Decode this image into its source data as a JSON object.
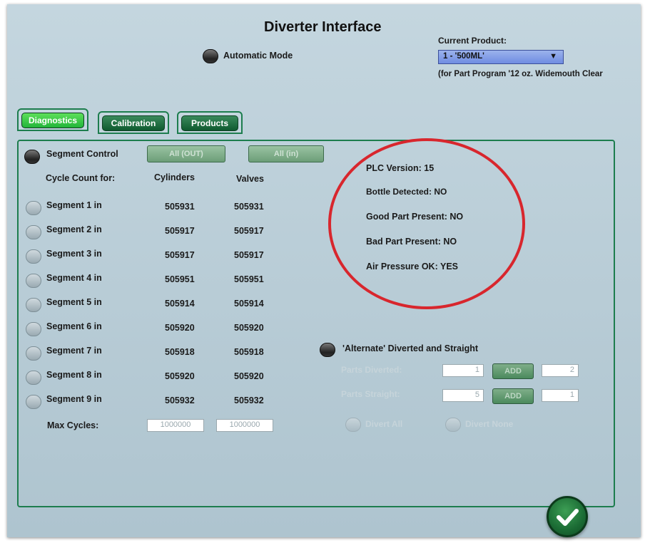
{
  "window": {
    "title": "Diverter Interface"
  },
  "header": {
    "automatic_mode_label": "Automatic Mode",
    "current_product_label": "Current Product:",
    "current_product_value": "1 - '500ML'",
    "part_program_note": "(for Part Program '12 oz. Widemouth Clear"
  },
  "tabs": [
    {
      "label": "Diagnostics",
      "active": true
    },
    {
      "label": "Calibration",
      "active": false
    },
    {
      "label": "Products",
      "active": false
    }
  ],
  "diagnostics": {
    "segment_control_label": "Segment Control",
    "all_out_label": "All (OUT)",
    "all_in_label": "All (in)",
    "cycle_count_label": "Cycle Count for:",
    "col_cylinders": "Cylinders",
    "col_valves": "Valves",
    "segments": [
      {
        "label": "Segment 1 in",
        "cylinders": "505931",
        "valves": "505931"
      },
      {
        "label": "Segment 2 in",
        "cylinders": "505917",
        "valves": "505917"
      },
      {
        "label": "Segment 3 in",
        "cylinders": "505917",
        "valves": "505917"
      },
      {
        "label": "Segment 4 in",
        "cylinders": "505951",
        "valves": "505951"
      },
      {
        "label": "Segment 5 in",
        "cylinders": "505914",
        "valves": "505914"
      },
      {
        "label": "Segment 6 in",
        "cylinders": "505920",
        "valves": "505920"
      },
      {
        "label": "Segment 7 in",
        "cylinders": "505918",
        "valves": "505918"
      },
      {
        "label": "Segment 8 in",
        "cylinders": "505920",
        "valves": "505920"
      },
      {
        "label": "Segment 9 in",
        "cylinders": "505932",
        "valves": "505932"
      }
    ],
    "max_cycles_label": "Max Cycles:",
    "max_cycles_cylinders": "1000000",
    "max_cycles_valves": "1000000"
  },
  "status": {
    "plc_version": "PLC Version: 15",
    "bottle_detected": "Bottle Detected: NO",
    "good_part_present": "Good Part Present: NO",
    "bad_part_present": "Bad Part Present: NO",
    "air_pressure_ok": "Air Pressure OK: YES"
  },
  "alternate": {
    "label": "'Alternate' Diverted and Straight",
    "parts_diverted_label": "Parts Diverted:",
    "parts_diverted_value": "1",
    "parts_diverted_add": "2",
    "parts_straight_label": "Parts Straight:",
    "parts_straight_value": "5",
    "parts_straight_add": "1",
    "add_label": "ADD",
    "divert_all_label": "Divert All",
    "divert_none_label": "Divert None"
  },
  "colors": {
    "accent_green": "#1d7d4e",
    "active_tab": "#2fc443",
    "highlight_circle": "#d8262d",
    "dropdown_blue": "#7b96e5"
  }
}
